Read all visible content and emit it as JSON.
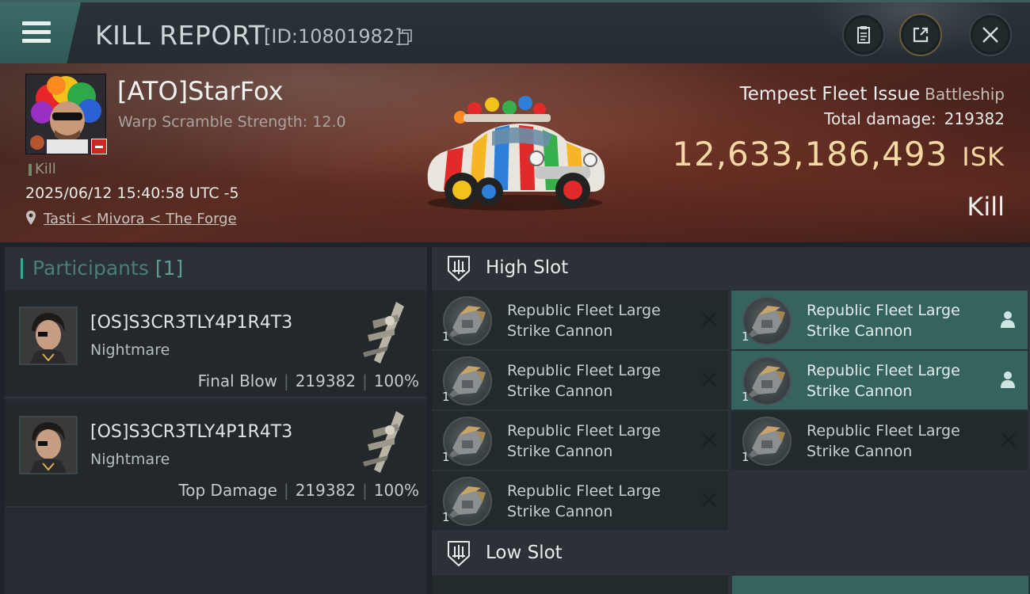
{
  "header": {
    "title": "KILL REPORT",
    "report_id": "[ID:10801982]"
  },
  "victim": {
    "name": "[ATO]StarFox",
    "subtitle": "Warp Scramble Strength: 12.0",
    "status_tag": "Kill",
    "datetime": "2025/06/12 15:40:58 UTC -5",
    "location": "Tasti < Mivora < The Forge",
    "ship_name": "Tempest Fleet Issue",
    "ship_class": "Battleship",
    "total_damage_label": "Total damage:",
    "total_damage": "219382",
    "isk_value": "12,633,186,493",
    "isk_unit": "ISK",
    "result": "Kill"
  },
  "participants": {
    "title": "Participants",
    "count": "[1]",
    "rows": [
      {
        "name": "[OS]S3CR3TLY4P1R4T3",
        "ship": "Nightmare",
        "role": "Final Blow",
        "damage": "219382",
        "percent": "100%"
      },
      {
        "name": "[OS]S3CR3TLY4P1R4T3",
        "ship": "Nightmare",
        "role": "Top Damage",
        "damage": "219382",
        "percent": "100%"
      }
    ]
  },
  "fitting": {
    "high_slot": {
      "title": "High Slot",
      "modules": [
        {
          "name": "Republic Fleet Large Strike Cannon",
          "qty": "1",
          "state": "destroyed"
        },
        {
          "name": "Republic Fleet Large Strike Cannon",
          "qty": "1",
          "state": "dropped"
        },
        {
          "name": "Republic Fleet Large Strike Cannon",
          "qty": "1",
          "state": "destroyed"
        },
        {
          "name": "Republic Fleet Large Strike Cannon",
          "qty": "1",
          "state": "dropped"
        },
        {
          "name": "Republic Fleet Large Strike Cannon",
          "qty": "1",
          "state": "destroyed"
        },
        {
          "name": "Republic Fleet Large Strike Cannon",
          "qty": "1",
          "state": "destroyed"
        },
        {
          "name": "Republic Fleet Large Strike Cannon",
          "qty": "1",
          "state": "destroyed"
        }
      ]
    },
    "low_slot": {
      "title": "Low Slot"
    }
  },
  "colors": {
    "accent": "#35645f",
    "isk_gold": "#f4d9a3",
    "banner_red": "#5a2c22"
  },
  "icons": [
    "menu-icon",
    "copy-icon",
    "clipboard-icon",
    "share-icon",
    "close-icon",
    "pin-icon",
    "slot-icon",
    "x-icon",
    "person-icon"
  ]
}
